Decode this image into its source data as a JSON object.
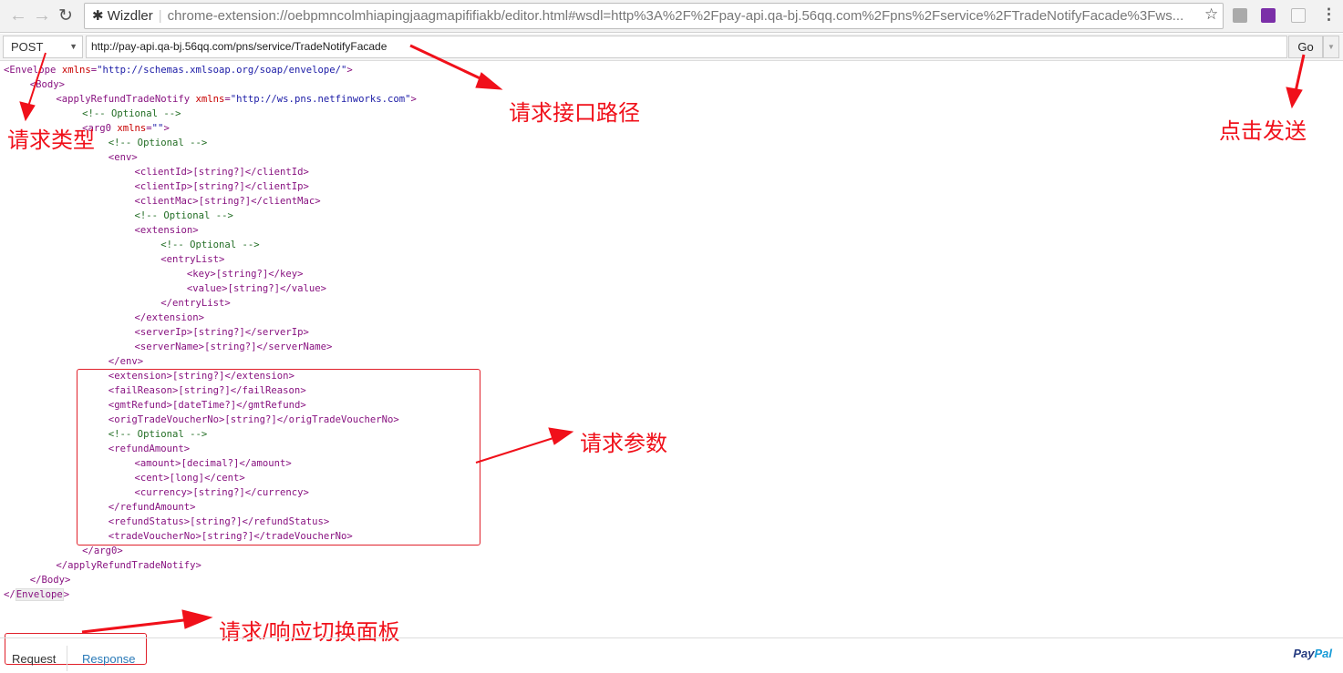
{
  "browser": {
    "extension_name": "Wizdler",
    "address": "chrome-extension://oebpmncolmhiapingjaagmapififiakb/editor.html#wsdl=http%3A%2F%2Fpay-api.qa-bj.56qq.com%2Fpns%2Fservice%2FTradeNotifyFacade%3Fws...",
    "icons": [
      "back-icon",
      "forward-icon",
      "reload-icon",
      "puzzle-icon",
      "star-icon",
      "menu-icon"
    ]
  },
  "toolbar": {
    "method": "POST",
    "url": "http://pay-api.qa-bj.56qq.com/pns/service/TradeNotifyFacade",
    "go_label": "Go"
  },
  "code_lines": [
    {
      "indent": 0,
      "text": "<Envelope xmlns=\"http://schemas.xmlsoap.org/soap/envelope/\">"
    },
    {
      "indent": 1,
      "text": "<Body>"
    },
    {
      "indent": 2,
      "text": "<applyRefundTradeNotify xmlns=\"http://ws.pns.netfinworks.com\">"
    },
    {
      "indent": 3,
      "text": "<!-- Optional -->"
    },
    {
      "indent": 3,
      "text": "<arg0 xmlns=\"\">"
    },
    {
      "indent": 4,
      "text": "<!-- Optional -->"
    },
    {
      "indent": 4,
      "text": "<env>"
    },
    {
      "indent": 5,
      "text": "<clientId>[string?]</clientId>"
    },
    {
      "indent": 5,
      "text": "<clientIp>[string?]</clientIp>"
    },
    {
      "indent": 5,
      "text": "<clientMac>[string?]</clientMac>"
    },
    {
      "indent": 5,
      "text": "<!-- Optional -->"
    },
    {
      "indent": 5,
      "text": "<extension>"
    },
    {
      "indent": 6,
      "text": "<!-- Optional -->"
    },
    {
      "indent": 6,
      "text": "<entryList>"
    },
    {
      "indent": 7,
      "text": "<key>[string?]</key>"
    },
    {
      "indent": 7,
      "text": "<value>[string?]</value>"
    },
    {
      "indent": 6,
      "text": "</entryList>"
    },
    {
      "indent": 5,
      "text": "</extension>"
    },
    {
      "indent": 5,
      "text": "<serverIp>[string?]</serverIp>"
    },
    {
      "indent": 5,
      "text": "<serverName>[string?]</serverName>"
    },
    {
      "indent": 4,
      "text": "</env>"
    },
    {
      "indent": 4,
      "text": "<extension>[string?]</extension>"
    },
    {
      "indent": 4,
      "text": "<failReason>[string?]</failReason>"
    },
    {
      "indent": 4,
      "text": "<gmtRefund>[dateTime?]</gmtRefund>"
    },
    {
      "indent": 4,
      "text": "<origTradeVoucherNo>[string?]</origTradeVoucherNo>"
    },
    {
      "indent": 4,
      "text": "<!-- Optional -->"
    },
    {
      "indent": 4,
      "text": "<refundAmount>"
    },
    {
      "indent": 5,
      "text": "<amount>[decimal?]</amount>"
    },
    {
      "indent": 5,
      "text": "<cent>[long]</cent>"
    },
    {
      "indent": 5,
      "text": "<currency>[string?]</currency>"
    },
    {
      "indent": 4,
      "text": "</refundAmount>"
    },
    {
      "indent": 4,
      "text": "<refundStatus>[string?]</refundStatus>"
    },
    {
      "indent": 4,
      "text": "<tradeVoucherNo>[string?]</tradeVoucherNo>"
    },
    {
      "indent": 3,
      "text": "</arg0>"
    },
    {
      "indent": 2,
      "text": "</applyRefundTradeNotify>"
    },
    {
      "indent": 1,
      "text": "</Body>"
    },
    {
      "indent": 0,
      "text": "</Envelope>"
    }
  ],
  "annotations": {
    "request_type": "请求类型",
    "request_path": "请求接口路径",
    "click_send": "点击发送",
    "request_params": "请求参数",
    "switch_panel": "请求/响应切换面板"
  },
  "tabs": [
    {
      "label": "Request",
      "active": true
    },
    {
      "label": "Response",
      "active": false
    }
  ],
  "footer": {
    "brand_a": "Pay",
    "brand_b": "Pal"
  },
  "colors": {
    "annotation": "#f0101a",
    "tag": "#881280",
    "attr": "#c80000",
    "value": "#1a1aa6",
    "comment": "#236e25",
    "link_tab": "#2a7ab8"
  }
}
